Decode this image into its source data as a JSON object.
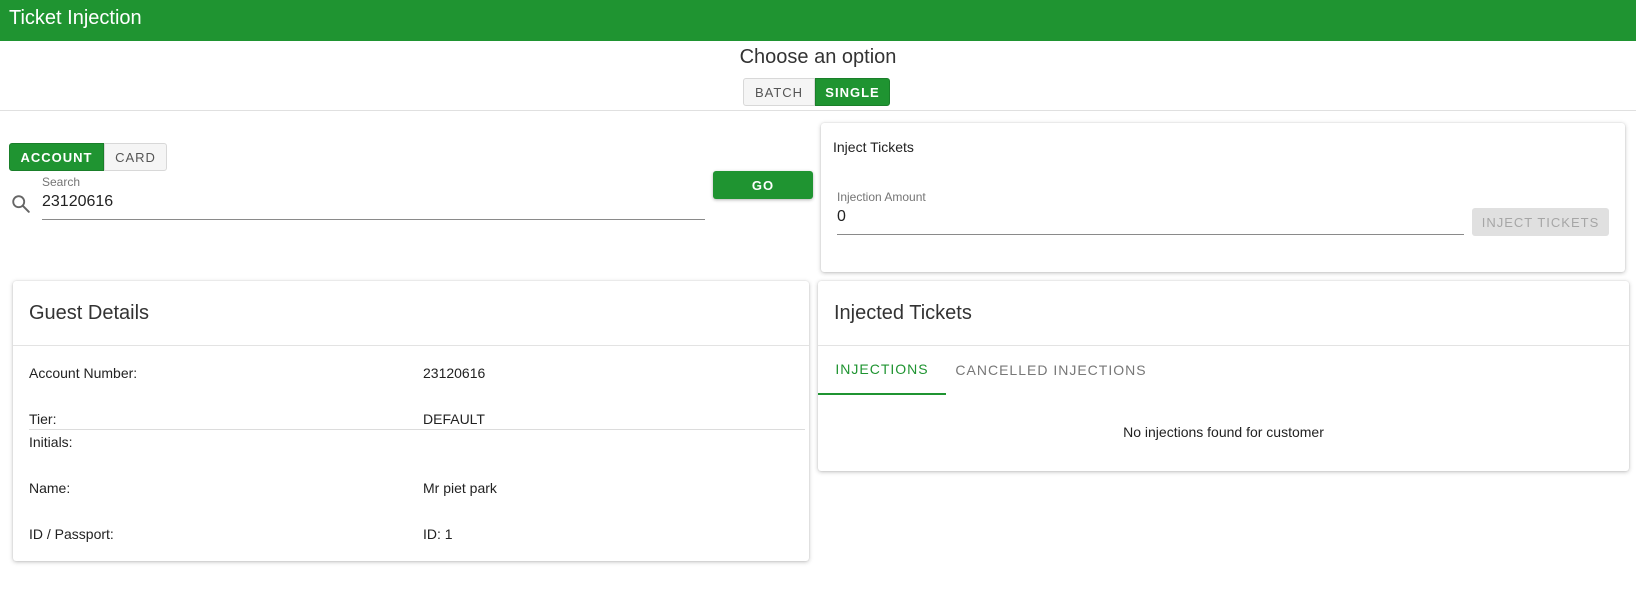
{
  "app": {
    "title": "Ticket Injection"
  },
  "mode": {
    "heading": "Choose an option",
    "options": {
      "batch": "BATCH",
      "single": "SINGLE"
    },
    "selected": "SINGLE"
  },
  "search": {
    "type_options": {
      "account": "ACCOUNT",
      "card": "CARD"
    },
    "selected_type": "ACCOUNT",
    "label": "Search",
    "value": "23120616",
    "go_label": "GO"
  },
  "inject": {
    "heading": "Inject Tickets",
    "amount_label": "Injection Amount",
    "amount_value": "0",
    "button_label": "INJECT TICKETS",
    "button_enabled": false
  },
  "guest": {
    "title": "Guest Details",
    "rows": [
      {
        "label": "Account Number:",
        "value": "23120616"
      },
      {
        "label": "Tier:",
        "value": "DEFAULT"
      },
      {
        "label": "Initials:",
        "value": ""
      },
      {
        "label": "Name:",
        "value": "Mr piet park"
      },
      {
        "label": "ID / Passport:",
        "value": "ID: 1"
      }
    ]
  },
  "tickets": {
    "title": "Injected Tickets",
    "tabs": [
      "INJECTIONS",
      "CANCELLED INJECTIONS"
    ],
    "active_tab": "INJECTIONS",
    "empty_message": "No injections found for customer"
  },
  "colors": {
    "primary": "#1f9431",
    "disabled_bg": "#e0e0e0",
    "disabled_text": "#a6a6a6"
  },
  "icons": {
    "search": "search-icon"
  }
}
